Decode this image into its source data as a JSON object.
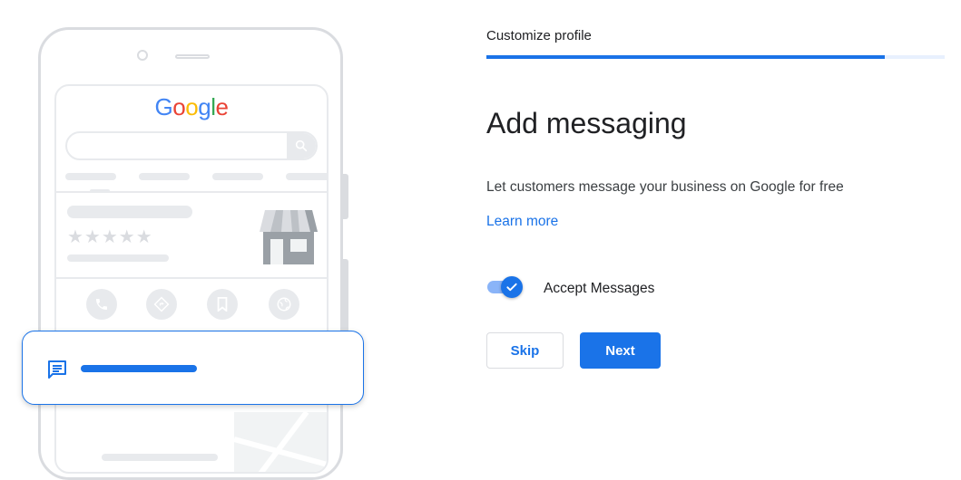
{
  "illustration": {
    "logo_letters": [
      {
        "ch": "G",
        "color": "#4285f4"
      },
      {
        "ch": "o",
        "color": "#ea4335"
      },
      {
        "ch": "o",
        "color": "#fbbc05"
      },
      {
        "ch": "g",
        "color": "#4285f4"
      },
      {
        "ch": "l",
        "color": "#34a853"
      },
      {
        "ch": "e",
        "color": "#ea4335"
      }
    ],
    "stars": "★★★★★",
    "action_icons": [
      "phone-icon",
      "directions-icon",
      "bookmark-icon",
      "website-icon"
    ],
    "message_icon": "chat-message-icon"
  },
  "header": {
    "step_label": "Customize profile",
    "progress": 0.87
  },
  "main": {
    "title": "Add messaging",
    "description": "Let customers message your business on Google for free",
    "learn_more": "Learn more",
    "toggle": {
      "label": "Accept Messages",
      "checked": true
    },
    "buttons": {
      "skip": "Skip",
      "next": "Next"
    }
  },
  "colors": {
    "accent": "#1a73e8",
    "progress_track": "#e8f0fe",
    "placeholder_gray": "#e8eaed"
  }
}
